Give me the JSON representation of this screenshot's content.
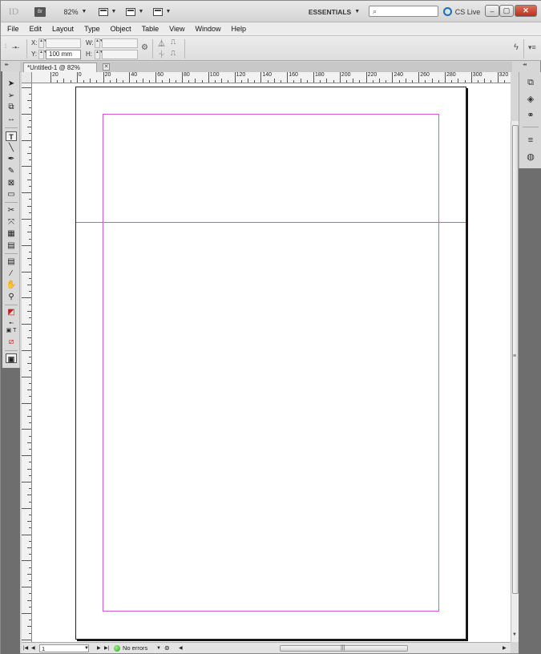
{
  "app": {
    "logo": "ID",
    "bridge_label": "Br",
    "zoom": "82%",
    "workspace": "ESSENTIALS",
    "cs_live": "CS Live",
    "search_placeholder": ""
  },
  "menu": [
    "File",
    "Edit",
    "Layout",
    "Type",
    "Object",
    "Table",
    "View",
    "Window",
    "Help"
  ],
  "control": {
    "x_label": "X:",
    "y_label": "Y:",
    "w_label": "W:",
    "h_label": "H:",
    "x_value": "",
    "y_value": "100 mm",
    "w_value": "",
    "h_value": ""
  },
  "tab": {
    "title": "*Untitled-1 @ 82%"
  },
  "ruler": {
    "labels": [
      "20",
      "0",
      "20",
      "40",
      "60",
      "80",
      "100",
      "120",
      "140",
      "160",
      "180",
      "200",
      "220",
      "240",
      "260",
      "280",
      "300",
      "320"
    ]
  },
  "status": {
    "page": "1",
    "errors": "No errors"
  },
  "tools": [
    "selection-tool",
    "direct-selection-tool",
    "page-tool",
    "gap-tool",
    "type-tool",
    "line-tool",
    "pen-tool",
    "pencil-tool",
    "rectangle-frame-tool",
    "rectangle-tool",
    "scissors-tool",
    "free-transform-tool",
    "gradient-swatch-tool",
    "gradient-feather-tool",
    "note-tool",
    "eyedropper-tool",
    "hand-tool",
    "zoom-tool"
  ],
  "colors": {
    "margin": "#d257d9",
    "guide": "#5b8fe6",
    "dock": "#6e6e6e"
  }
}
